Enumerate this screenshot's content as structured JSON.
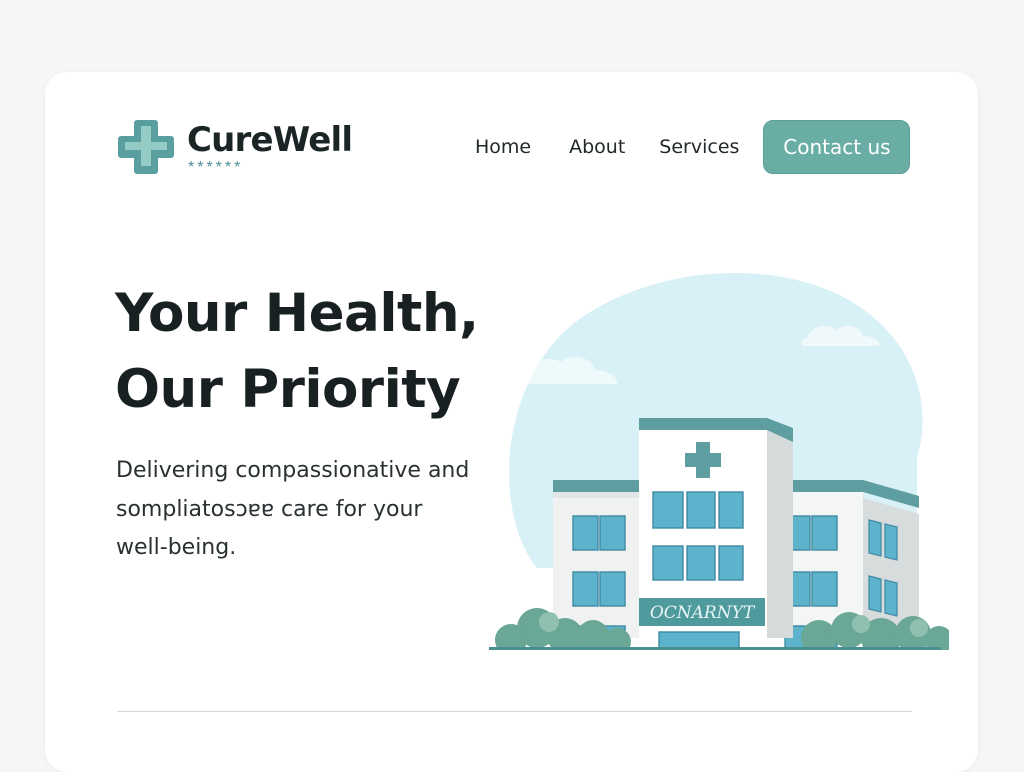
{
  "brand": {
    "name": "CureWell",
    "stars": "******"
  },
  "nav": {
    "items": [
      {
        "label": "Home"
      },
      {
        "label": "About"
      },
      {
        "label": "Services"
      }
    ],
    "cta_label": "Contact us"
  },
  "hero": {
    "title_line1": "Your Health,",
    "title_line2": "Our Priority",
    "subtitle": "Delivering compassionative and sompliatosɔɐɐ care for your well-being."
  },
  "illustration": {
    "sign_text": "OCNARNYT"
  },
  "colors": {
    "accent": "#69ada5",
    "brand_teal": "#5a9a9c",
    "sky": "#d8f1f6",
    "text_dark": "#1c2526"
  }
}
